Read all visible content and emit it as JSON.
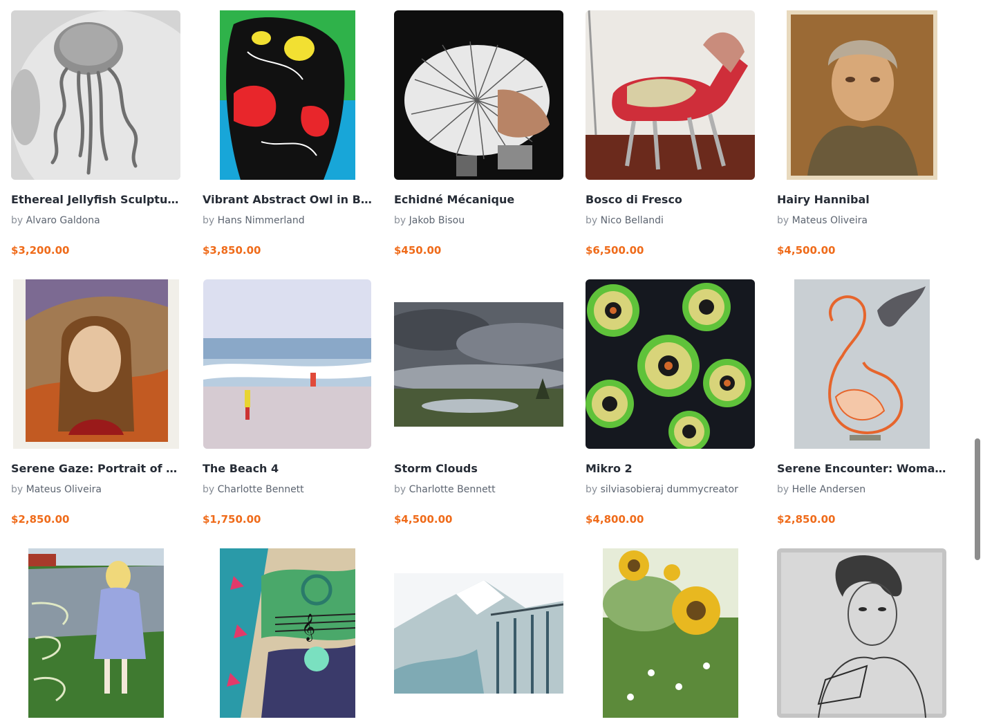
{
  "by_prefix": "by",
  "artworks": [
    {
      "title": "Ethereal Jellyfish Sculpture i...",
      "artist": "Alvaro Galdona",
      "price": "$3,200.00"
    },
    {
      "title": "Vibrant Abstract Owl in Bold ...",
      "artist": "Hans Nimmerland",
      "price": "$3,850.00"
    },
    {
      "title": "Echidné Mécanique",
      "artist": "Jakob Bisou",
      "price": "$450.00"
    },
    {
      "title": "Bosco di Fresco",
      "artist": "Nico Bellandi",
      "price": "$6,500.00"
    },
    {
      "title": "Hairy Hannibal",
      "artist": "Mateus Oliveira",
      "price": "$4,500.00"
    },
    {
      "title": "Serene Gaze: Portrait of a Yo...",
      "artist": "Mateus Oliveira",
      "price": "$2,850.00"
    },
    {
      "title": "The Beach 4",
      "artist": "Charlotte Bennett",
      "price": "$1,750.00"
    },
    {
      "title": "Storm Clouds",
      "artist": "Charlotte Bennett",
      "price": "$4,500.00"
    },
    {
      "title": "Mikro 2",
      "artist": "silviasobieraj dummycreator",
      "price": "$4,800.00"
    },
    {
      "title": "Serene Encounter: Woman a...",
      "artist": "Helle Andersen",
      "price": "$2,850.00"
    },
    {
      "title": "",
      "artist": "",
      "price": ""
    },
    {
      "title": "",
      "artist": "",
      "price": ""
    },
    {
      "title": "",
      "artist": "",
      "price": ""
    },
    {
      "title": "",
      "artist": "",
      "price": ""
    },
    {
      "title": "",
      "artist": "",
      "price": ""
    }
  ],
  "colors": {
    "price": "#ef6b1a",
    "title": "#262c36",
    "artist": "#5c6470"
  }
}
